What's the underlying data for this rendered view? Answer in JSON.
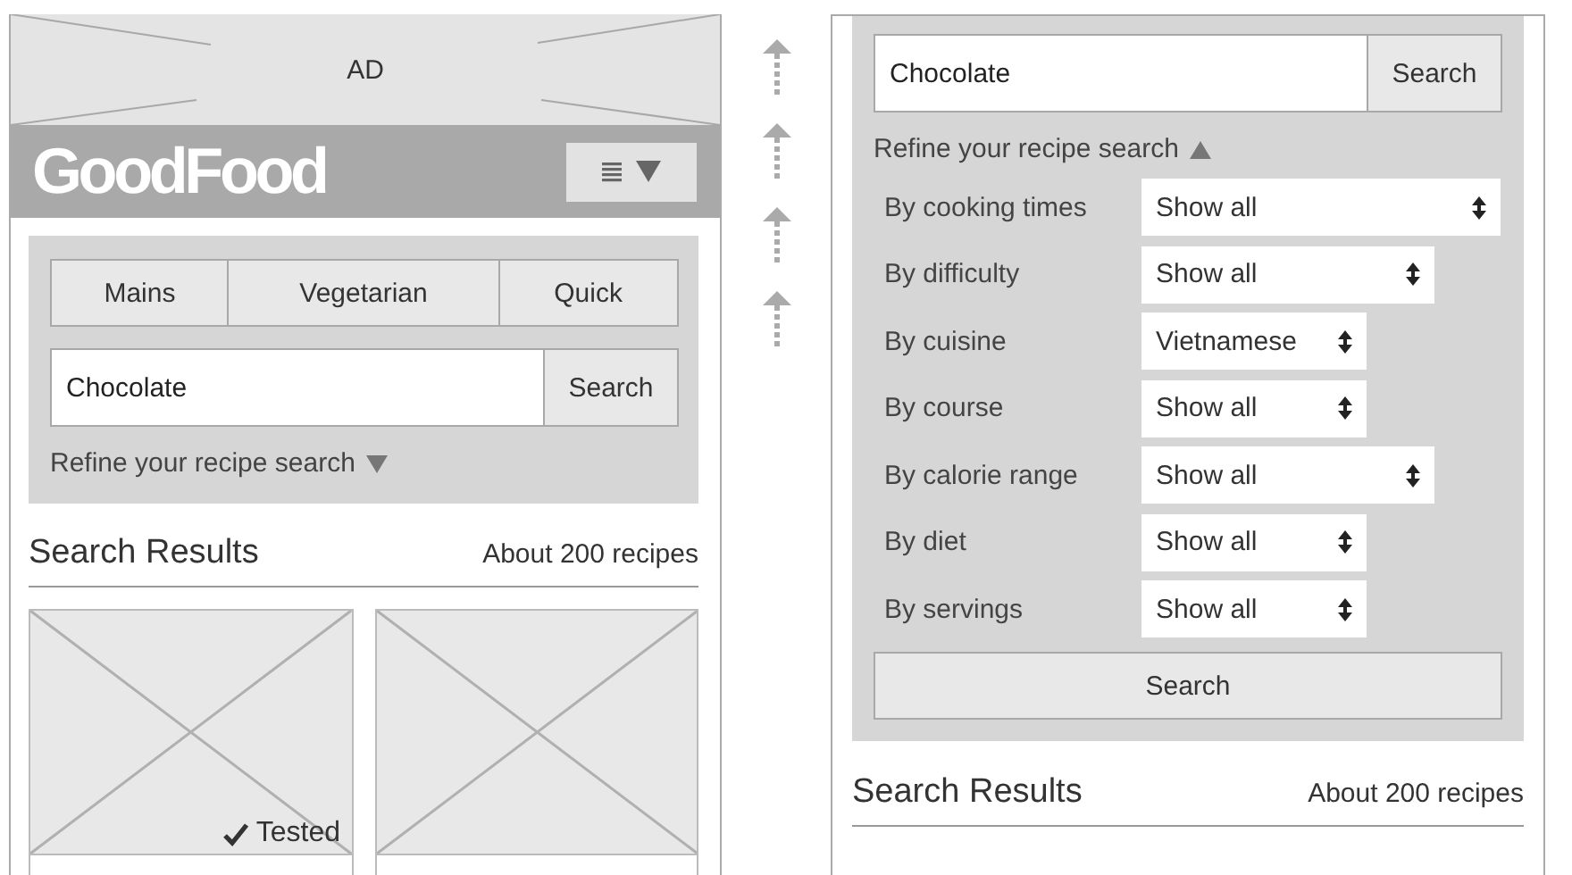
{
  "mobile_view": {
    "ad": {
      "label": "AD"
    },
    "logo": "GoodFood",
    "tabs": [
      {
        "label": "Mains"
      },
      {
        "label": "Vegetarian"
      },
      {
        "label": "Quick"
      }
    ],
    "search": {
      "value": "Chocolate",
      "button": "Search"
    },
    "refine": {
      "label": "Refine your recipe search",
      "expanded": false
    },
    "results": {
      "title": "Search Results",
      "count": "About 200 recipes"
    },
    "cards": [
      {
        "tested": true,
        "badge": "Tested"
      },
      {
        "tested": false
      }
    ]
  },
  "expanded_view": {
    "search": {
      "value": "Chocolate",
      "button": "Search"
    },
    "refine": {
      "label": "Refine your recipe search",
      "expanded": true
    },
    "filters": [
      {
        "label": "By cooking times",
        "value": "Show all"
      },
      {
        "label": "By difficulty",
        "value": "Show all"
      },
      {
        "label": "By cuisine",
        "value": "Vietnamese"
      },
      {
        "label": "By course",
        "value": "Show all"
      },
      {
        "label": "By calorie range",
        "value": "Show all"
      },
      {
        "label": "By diet",
        "value": "Show all"
      },
      {
        "label": "By servings",
        "value": "Show all"
      }
    ],
    "submit": "Search",
    "results": {
      "title": "Search Results",
      "count": "About 200 recipes"
    }
  }
}
